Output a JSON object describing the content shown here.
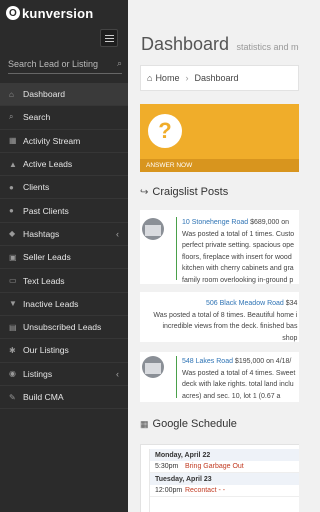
{
  "app": {
    "logo_mark": "O",
    "logo_text": "kunversion"
  },
  "sidebar": {
    "search_placeholder": "Search Lead or Listing",
    "items": [
      {
        "label": "Dashboard",
        "icon": "home-icon",
        "glyph": "⌂"
      },
      {
        "label": "Search",
        "icon": "search-icon",
        "glyph": "⌕"
      },
      {
        "label": "Activity Stream",
        "icon": "activity-icon",
        "glyph": "▦"
      },
      {
        "label": "Active Leads",
        "icon": "thumbs-up-icon",
        "glyph": "▲"
      },
      {
        "label": "Clients",
        "icon": "user-icon",
        "glyph": "●"
      },
      {
        "label": "Past Clients",
        "icon": "users-icon",
        "glyph": "●"
      },
      {
        "label": "Hashtags",
        "icon": "tag-icon",
        "glyph": "◆"
      },
      {
        "label": "Seller Leads",
        "icon": "seller-icon",
        "glyph": "▣"
      },
      {
        "label": "Text Leads",
        "icon": "text-icon",
        "glyph": "▭"
      },
      {
        "label": "Inactive Leads",
        "icon": "thumbs-down-icon",
        "glyph": "▼"
      },
      {
        "label": "Unsubscribed Leads",
        "icon": "trash-icon",
        "glyph": "▤"
      },
      {
        "label": "Our Listings",
        "icon": "gear-icon",
        "glyph": "✱"
      },
      {
        "label": "Listings",
        "icon": "map-pin-icon",
        "glyph": "◉"
      },
      {
        "label": "Build CMA",
        "icon": "wrench-icon",
        "glyph": "✎"
      }
    ]
  },
  "header": {
    "title": "Dashboard",
    "subtitle": "statistics and more"
  },
  "breadcrumb": {
    "home": "Home",
    "current": "Dashboard"
  },
  "tile": {
    "glyph": "?",
    "footer": "ANSWER NOW",
    "color": "#f0ad2a"
  },
  "craigslist": {
    "heading": "Craigslist Posts",
    "posts": [
      {
        "title": "10 Stonehenge Road",
        "price": " $689,000 on",
        "lines": [
          "Was posted a total of 1 times. Custo",
          "perfect private setting. spacious ope",
          "floors, fireplace with insert for wood",
          "kitchen with cherry cabinets and gra",
          "family room overlooking in-ground p"
        ]
      },
      {
        "title": "506 Black Meadow Road",
        "price": " $34",
        "lines": [
          "Was posted a total of 8 times. Beautiful home i",
          "incredible views from the deck. finished bas",
          "shop"
        ]
      },
      {
        "title": "548 Lakes Road",
        "price": " $195,000 on 4/18/",
        "lines": [
          "Was posted a total of 4 times. Sweet",
          "deck with lake rights. total land inclu",
          "acres) and sec. 10, lot 1 (0.67 a"
        ]
      }
    ]
  },
  "schedule": {
    "heading": "Google Schedule",
    "days": [
      {
        "label": "Monday, April 22",
        "events": [
          {
            "time": "5:30pm",
            "title": "Bring Garbage Out"
          }
        ]
      },
      {
        "label": "Tuesday, April 23",
        "events": [
          {
            "time": "12:00pm",
            "title": "Recontact - -"
          }
        ]
      }
    ]
  }
}
